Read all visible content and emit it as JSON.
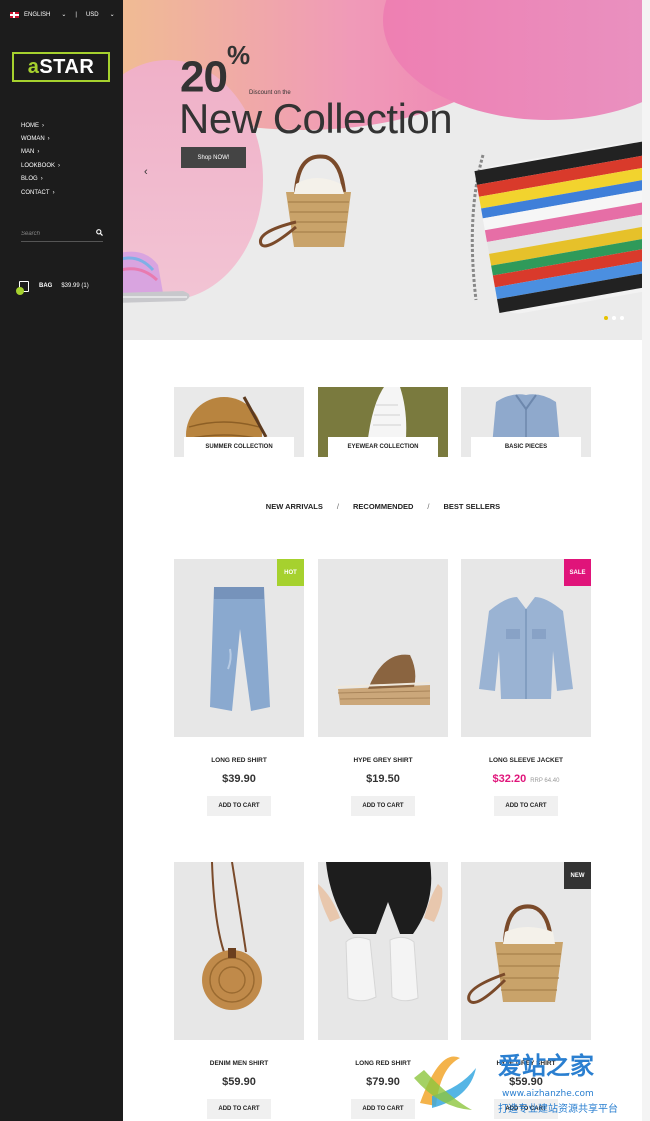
{
  "sidebar": {
    "language": "ENGLISH",
    "currency": "USD",
    "logo_prefix": "a",
    "logo_rest": "STAR",
    "nav": [
      "HOME",
      "WOMAN",
      "MAN",
      "LOOKBOOK",
      "BLOG",
      "CONTACT"
    ],
    "search_placeholder": "Search",
    "bag_label": "BAG",
    "bag_total": "$39.99 (1)"
  },
  "hero": {
    "percent": "20",
    "percent_sign": "%",
    "discount_text": "Discount on the",
    "headline": "New Collection",
    "cta": "Shop NOW!",
    "prev_arrow": "‹",
    "slide_count": 3,
    "active_slide": 1
  },
  "collections": [
    {
      "label": "SUMMER COLLECTION"
    },
    {
      "label": "EYEWEAR COLLECTION"
    },
    {
      "label": "BASIC PIECES"
    }
  ],
  "tabs": {
    "new": "NEW ARRIVALS",
    "recommended": "RECOMMENDED",
    "best": "BEST SELLERS",
    "separator": "/"
  },
  "products": [
    {
      "name": "LONG RED SHIRT",
      "price": "$39.90",
      "badge": "HOT",
      "badge_color": "#a6d12e",
      "button": "ADD TO CART"
    },
    {
      "name": "HYPE GREY SHIRT",
      "price": "$19.50",
      "button": "ADD TO CART"
    },
    {
      "name": "LONG SLEEVE JACKET",
      "price": "$32.20",
      "rrp": "RRP 64.40",
      "badge": "SALE",
      "badge_color": "#e0147a",
      "button": "ADD TO CART"
    },
    {
      "name": "DENIM MEN SHIRT",
      "price": "$59.90",
      "button": "ADD TO CART"
    },
    {
      "name": "LONG RED SHIRT",
      "price": "$79.90",
      "button": "ADD TO CART"
    },
    {
      "name": "HYPE GREY SHIRT",
      "price": "$59.90",
      "badge": "NEW",
      "badge_color": "#333333",
      "button": "ADD TO CART"
    }
  ],
  "watermark": {
    "brand": "爱站之家",
    "url": "www.aizhanzhe.com",
    "tagline": "打造专业建站资源共享平台"
  },
  "colors": {
    "sidebar_bg": "#1c1c1c",
    "accent": "#a6d12e",
    "sale": "#e0147a"
  }
}
